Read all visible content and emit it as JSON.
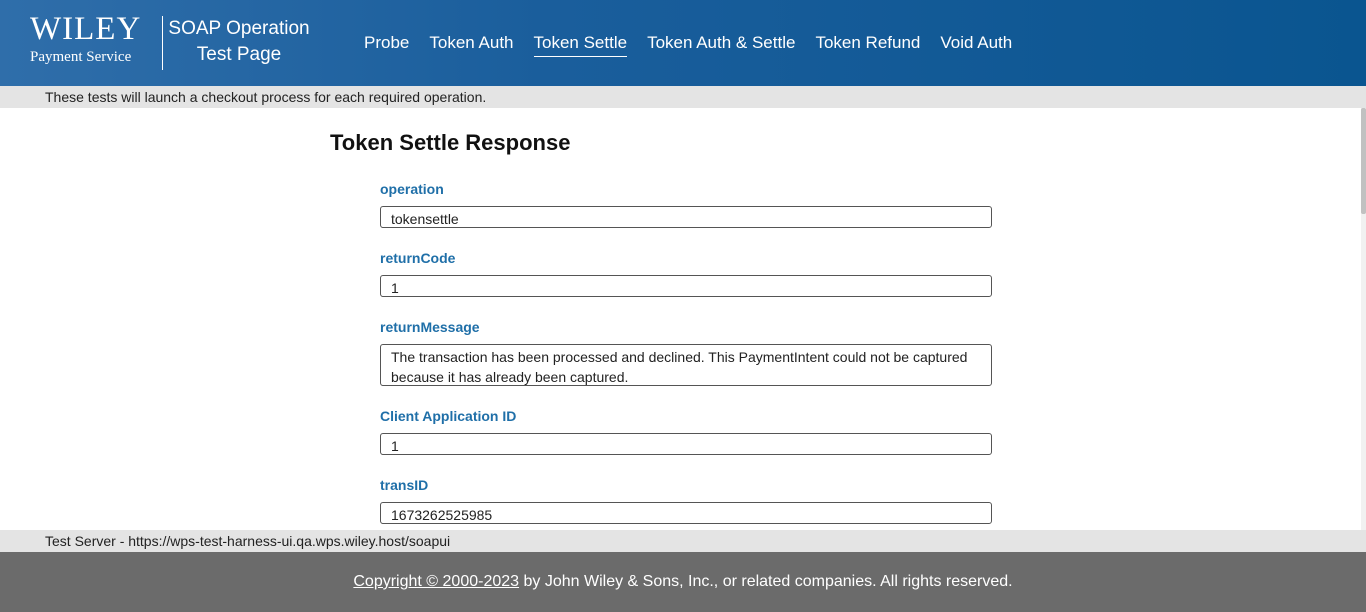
{
  "header": {
    "logo_word": "WILEY",
    "logo_sub": "Payment Service",
    "title_line1": "SOAP Operation",
    "title_line2": "Test Page",
    "nav": [
      {
        "label": "Probe"
      },
      {
        "label": "Token Auth"
      },
      {
        "label": "Token Settle",
        "active": true
      },
      {
        "label": "Token Auth & Settle"
      },
      {
        "label": "Token Refund"
      },
      {
        "label": "Void Auth"
      }
    ]
  },
  "info_text": "These tests will launch a checkout process for each required operation.",
  "page_title": "Token Settle Response",
  "fields": [
    {
      "label": "operation",
      "value": "tokensettle"
    },
    {
      "label": "returnCode",
      "value": "1"
    },
    {
      "label": "returnMessage",
      "value": "The transaction has been processed and declined. This PaymentIntent could not be captured because it has already been captured."
    },
    {
      "label": "Client Application ID",
      "value": "1"
    },
    {
      "label": "transID",
      "value": "1673262525985"
    }
  ],
  "server_text": "Test Server - https://wps-test-harness-ui.qa.wps.wiley.host/soapui",
  "footer": {
    "copyright_link": "Copyright © 2000-2023",
    "copyright_rest": " by John Wiley & Sons, Inc., or related companies. All rights reserved."
  },
  "colors": {
    "header_start": "#2f6eaa",
    "header_end": "#0a5590",
    "label_blue": "#1f6fa8",
    "bar_gray": "#e4e4e4",
    "footer_gray": "#6b6b6b"
  }
}
